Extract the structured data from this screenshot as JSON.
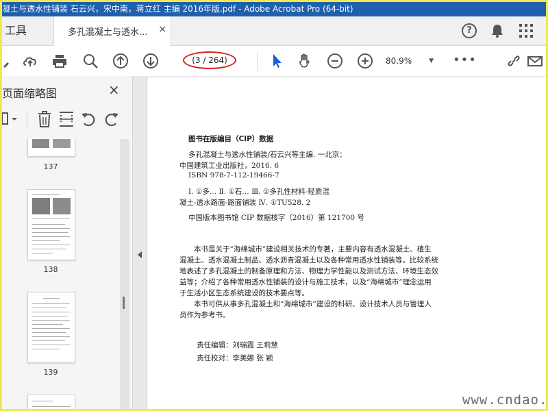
{
  "window": {
    "title": "凝土与透水性铺装 石云兴，宋中南，蒋立红 主编 2016年版.pdf - Adobe Acrobat Pro (64-bit)"
  },
  "tabs": {
    "tools_label": "工具",
    "document_label": "多孔混凝土与透水...",
    "close_symbol": "×"
  },
  "toolbar": {
    "page_indicator": "(3 / 264)",
    "zoom_value": "80.9%",
    "more_label": "•••"
  },
  "sidebar": {
    "title": "页面缩略图",
    "close_symbol": "×",
    "thumbnails": [
      {
        "page": "137"
      },
      {
        "page": "138"
      },
      {
        "page": "139"
      }
    ]
  },
  "document": {
    "lines": [
      "图书在版编目（CIP）数据",
      "多孔混凝土与透水性铺装/石云兴等主编. 一北京：",
      "中国建筑工业出版社，2016. 6",
      "ISBN 978-7-112-19466-7",
      "Ⅰ. ①多…  Ⅱ. ①石…  Ⅲ. ①多孔性材料-轻质混",
      "凝土-透水路面-路面铺装  Ⅳ. ①TU528. 2",
      "中国版本图书馆 CIP 数据核字（2016）第 121700 号",
      "本书是关于“海绵城市”建设相关技术的专著，主要内容有透水混凝土、植生",
      "混凝土、透水混凝土制品、透水沥青混凝土以及各种常用透水性铺装等。比较系统",
      "地表述了多孔混凝土的制备原理和方法、物理力学性能以及测试方法、环境生态效",
      "益等；介绍了各种常用透水性铺装的设计与施工技术，以及“海绵城市”理念运用",
      "于生活小区生态系统建设的技术要点等。",
      "本书可供从事多孔混凝土和“海绵城市”建设的科研、设计技术人员与管理人",
      "员作为参考书。",
      "责任编辑：刘瑞霞  王莉慧",
      "责任校对：李美娜  张  颖"
    ],
    "watermark": "www.cndao.com"
  },
  "colors": {
    "titlebar": "#1f5fae",
    "border": "#f2e84a",
    "highlight": "#d8201c",
    "select_tool": "#1a5bd8"
  }
}
